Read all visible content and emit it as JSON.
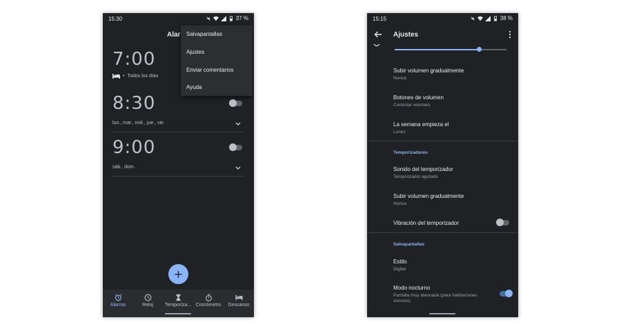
{
  "phone1": {
    "status": {
      "time": "15:30",
      "battery": "37 %"
    },
    "title_partial": "Aları",
    "menu": {
      "items": [
        {
          "label": "Salvapantallas"
        },
        {
          "label": "Ajustes"
        },
        {
          "label": "Enviar comentarios"
        },
        {
          "label": "Ayuda"
        }
      ]
    },
    "alarms": [
      {
        "time": "7:00",
        "days": "Todos los días",
        "enabled": false
      },
      {
        "time": "8:30",
        "days": "lun., mar., mié., jue., vie.",
        "enabled": false
      },
      {
        "time": "9:00",
        "days": "sáb., dom.",
        "enabled": false
      }
    ],
    "fab": {
      "label": "+"
    },
    "nav": [
      {
        "label": "Alarma",
        "icon": "alarm-icon",
        "active": true
      },
      {
        "label": "Reloj",
        "icon": "clock-icon",
        "active": false
      },
      {
        "label": "Temporiza...",
        "icon": "hourglass-icon",
        "active": false
      },
      {
        "label": "Cronómetro",
        "icon": "stopwatch-icon",
        "active": false
      },
      {
        "label": "Descanso",
        "icon": "bed-icon",
        "active": false
      }
    ],
    "colors": {
      "accent": "#8ab4f8",
      "background": "#202124"
    }
  },
  "phone2": {
    "status": {
      "time": "15:15",
      "battery": "38 %"
    },
    "title": "Ajustes",
    "volume_slider": {
      "value": 0.75
    },
    "settings_top": [
      {
        "title": "Subir volumen gradualmente",
        "subtitle": "Nunca"
      },
      {
        "title": "Botones de volumen",
        "subtitle": "Controlar volumen"
      },
      {
        "title": "La semana empieza el",
        "subtitle": "Lunes"
      }
    ],
    "section_timers": "Temporizadores",
    "settings_timers": [
      {
        "title": "Sonido del temporizador",
        "subtitle": "Temporizador agotado"
      },
      {
        "title": "Subir volumen gradualmente",
        "subtitle": "Nunca"
      },
      {
        "title": "Vibración del temporizador",
        "enabled": false
      }
    ],
    "section_screensaver": "Salvapantallas",
    "settings_screensaver": [
      {
        "title": "Estilo",
        "subtitle": "Digital"
      },
      {
        "title": "Modo nocturno",
        "subtitle": "Pantalla muy atenuada (para habitaciones oscuras)",
        "enabled": true
      }
    ]
  }
}
